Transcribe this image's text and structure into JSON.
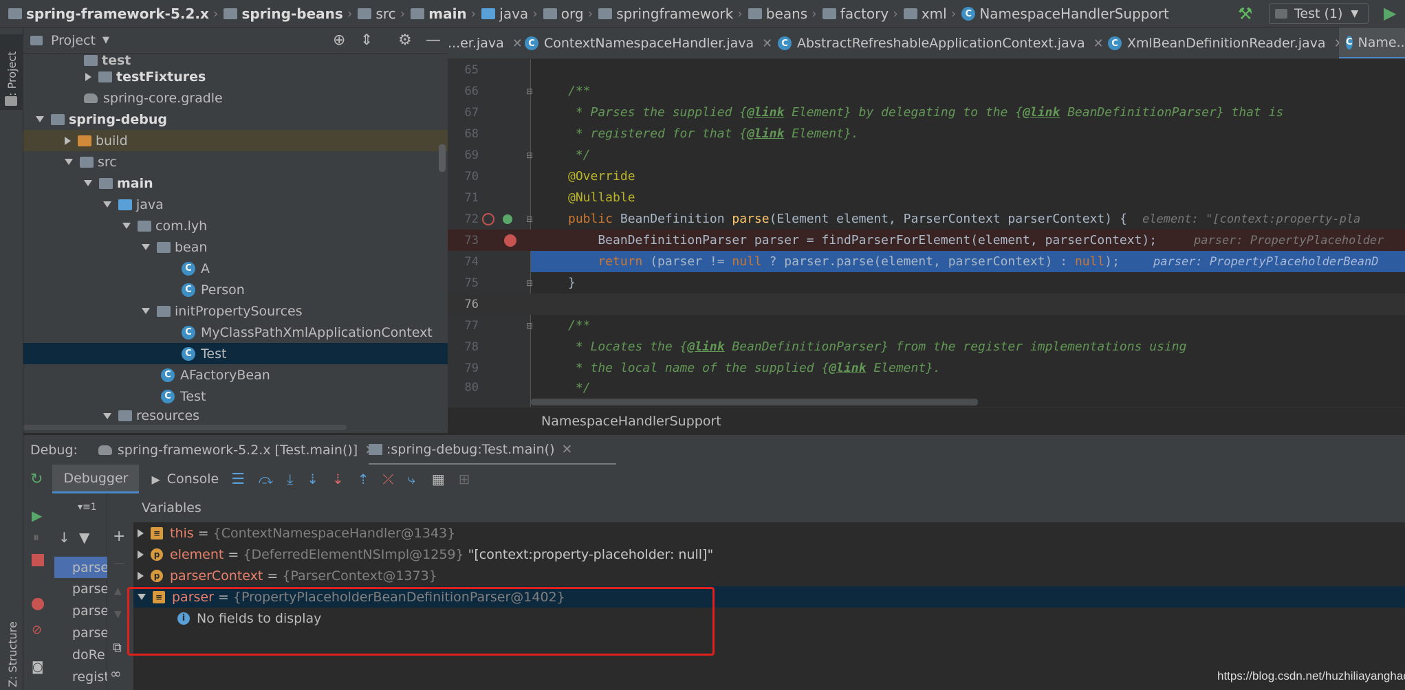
{
  "breadcrumbs": [
    "spring-framework-5.2.x",
    "spring-beans",
    "src",
    "main",
    "java",
    "org",
    "springframework",
    "beans",
    "factory",
    "xml",
    "NamespaceHandlerSupport"
  ],
  "run_config": "Test (1)",
  "side_tabs": {
    "project": "1: Project",
    "structure": "Z: Structure"
  },
  "project_panel": {
    "title": "Project",
    "tree": [
      {
        "label": "test",
        "type": "folder"
      },
      {
        "label": "testFixtures",
        "type": "folder"
      },
      {
        "label": "spring-core.gradle",
        "type": "gradle"
      },
      {
        "label": "spring-debug",
        "type": "module"
      },
      {
        "label": "build",
        "type": "folder"
      },
      {
        "label": "src",
        "type": "folder"
      },
      {
        "label": "main",
        "type": "folder"
      },
      {
        "label": "java",
        "type": "folder"
      },
      {
        "label": "com.lyh",
        "type": "package"
      },
      {
        "label": "bean",
        "type": "package"
      },
      {
        "label": "A",
        "type": "class"
      },
      {
        "label": "Person",
        "type": "class"
      },
      {
        "label": "initPropertySources",
        "type": "package"
      },
      {
        "label": "MyClassPathXmlApplicationContext",
        "type": "class"
      },
      {
        "label": "Test",
        "type": "class"
      },
      {
        "label": "AFactoryBean",
        "type": "class"
      },
      {
        "label": "Test",
        "type": "class"
      },
      {
        "label": "resources",
        "type": "folder"
      }
    ]
  },
  "editor_tabs": [
    "...er.java",
    "ContextNamespaceHandler.java",
    "AbstractRefreshableApplicationContext.java",
    "XmlBeanDefinitionReader.java",
    "Name..."
  ],
  "code": {
    "line_numbers": [
      "65",
      "66",
      "67",
      "68",
      "69",
      "70",
      "71",
      "72",
      "73",
      "74",
      "75",
      "76",
      "77",
      "78",
      "79",
      "80"
    ],
    "l66": "/**",
    "l67_a": " * Parses the supplied {",
    "l67_tag1": "@link",
    "l67_b": " Element} by delegating to the {",
    "l67_tag2": "@link",
    "l67_c": " BeanDefinitionParser} that is",
    "l68_a": " * registered for that {",
    "l68_tag": "@link",
    "l68_b": " Element}.",
    "l69": " */",
    "l70": "@Override",
    "l71": "@Nullable",
    "l72_kw": "public",
    "l72_a": " BeanDefinition ",
    "l72_fn": "parse",
    "l72_b": "(Element element, ParserContext parserContext) {",
    "l72_hint": "element: \"[context:property-pla",
    "l73_a": "    BeanDefinitionParser parser = findParserForElement(element, parserContext);",
    "l73_hint": "parser: PropertyPlaceholder",
    "l74_kw": "    return",
    "l74_a": " (parser != ",
    "l74_null1": "null",
    "l74_b": " ? parser.parse(element, parserContext) : ",
    "l74_null2": "null",
    "l74_c": ");",
    "l74_hint": "parser: PropertyPlaceholderBeanD",
    "l75": "}",
    "l77": "/**",
    "l78_a": " * Locates the {",
    "l78_tag": "@link",
    "l78_b": " BeanDefinitionParser} from the register implementations using",
    "l79_a": " * the local name of the supplied {",
    "l79_tag": "@link",
    "l79_b": " Element}.",
    "l80": " */"
  },
  "editor_breadcrumb": "NamespaceHandlerSupport",
  "debug": {
    "label": "Debug:",
    "sessions": [
      "spring-framework-5.2.x [Test.main()]",
      ":spring-debug:Test.main()"
    ],
    "tabs": {
      "debugger": "Debugger",
      "console": "Console"
    },
    "variables_title": "Variables",
    "threads_label": "1",
    "frames": [
      "parse",
      "parse",
      "parse",
      "parse",
      "doRe",
      "regist"
    ],
    "variables": [
      {
        "name": "this",
        "value": "{ContextNamespaceHandler@1343}",
        "extra": ""
      },
      {
        "name": "element",
        "value": "{DeferredElementNSImpl@1259}",
        "extra": "\"[context:property-placeholder: null]\""
      },
      {
        "name": "parserContext",
        "value": "{ParserContext@1373}",
        "extra": ""
      },
      {
        "name": "parser",
        "value": "{PropertyPlaceholderBeanDefinitionParser@1402}",
        "extra": ""
      }
    ],
    "no_fields": "No fields to display"
  },
  "watermark": "https://blog.csdn.net/huzhiliayanghao",
  "colors": {
    "accent_blue": "#2d5ca0",
    "selection": "#0d293e",
    "highlight_box": "#e0201c",
    "keyword": "#cc7832",
    "comment": "#629755"
  }
}
